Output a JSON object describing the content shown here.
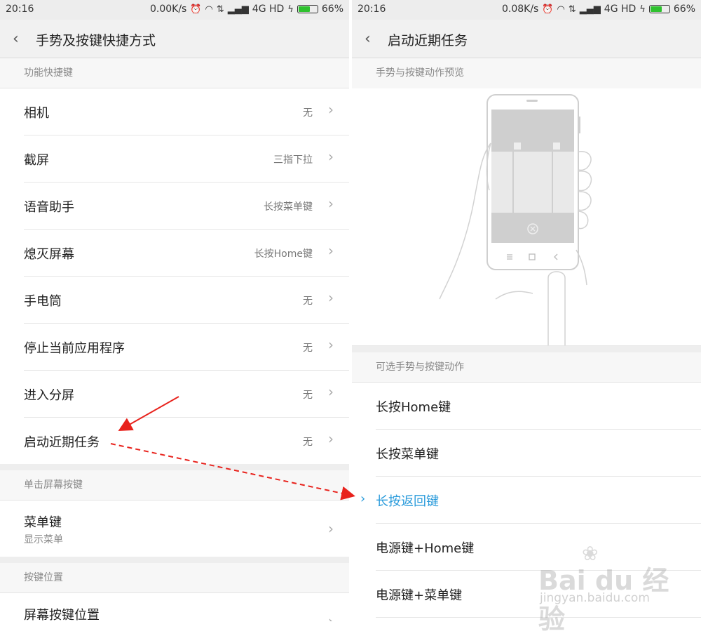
{
  "status": {
    "time": "20:16",
    "left_speed": "0.00K/s",
    "right_speed": "0.08K/s",
    "network": "4G HD",
    "battery": "66%",
    "battery_level": 0.66
  },
  "left": {
    "title": "手势及按键快捷方式",
    "section1": "功能快捷键",
    "rows": [
      {
        "label": "相机",
        "value": "无"
      },
      {
        "label": "截屏",
        "value": "三指下拉"
      },
      {
        "label": "语音助手",
        "value": "长按菜单键"
      },
      {
        "label": "熄灭屏幕",
        "value": "长按Home键"
      },
      {
        "label": "手电筒",
        "value": "无"
      },
      {
        "label": "停止当前应用程序",
        "value": "无"
      },
      {
        "label": "进入分屏",
        "value": "无"
      },
      {
        "label": "启动近期任务",
        "value": "无"
      }
    ],
    "section2": "单击屏幕按键",
    "menu_key": {
      "label": "菜单键",
      "sub": "显示菜单"
    },
    "section3": "按键位置",
    "key_pos": {
      "label": "屏幕按键位置"
    }
  },
  "right": {
    "title": "启动近期任务",
    "preview_header": "手势与按键动作预览",
    "options_header": "可选手势与按键动作",
    "options": [
      {
        "label": "长按Home键",
        "selected": false
      },
      {
        "label": "长按菜单键",
        "selected": false
      },
      {
        "label": "长按返回键",
        "selected": true
      },
      {
        "label": "电源键+Home键",
        "selected": false
      },
      {
        "label": "电源键+菜单键",
        "selected": false
      }
    ]
  },
  "icons": {
    "back": "chevron-left-icon",
    "chevron": "chevron-right-icon",
    "selected_mark": "chevron-right-icon"
  },
  "colors": {
    "accent": "#2a9bdb",
    "annotation": "#e8221c",
    "battery_fill": "#2ec12e"
  },
  "watermark": {
    "text": "Bai du 经验",
    "sub": "jingyan.baidu.com"
  }
}
